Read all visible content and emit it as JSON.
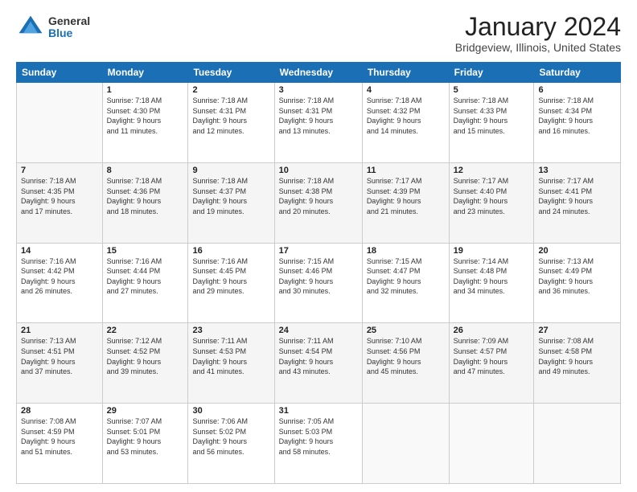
{
  "logo": {
    "general": "General",
    "blue": "Blue"
  },
  "title": "January 2024",
  "subtitle": "Bridgeview, Illinois, United States",
  "days_of_week": [
    "Sunday",
    "Monday",
    "Tuesday",
    "Wednesday",
    "Thursday",
    "Friday",
    "Saturday"
  ],
  "weeks": [
    [
      {
        "day": "",
        "info": ""
      },
      {
        "day": "1",
        "info": "Sunrise: 7:18 AM\nSunset: 4:30 PM\nDaylight: 9 hours\nand 11 minutes."
      },
      {
        "day": "2",
        "info": "Sunrise: 7:18 AM\nSunset: 4:31 PM\nDaylight: 9 hours\nand 12 minutes."
      },
      {
        "day": "3",
        "info": "Sunrise: 7:18 AM\nSunset: 4:31 PM\nDaylight: 9 hours\nand 13 minutes."
      },
      {
        "day": "4",
        "info": "Sunrise: 7:18 AM\nSunset: 4:32 PM\nDaylight: 9 hours\nand 14 minutes."
      },
      {
        "day": "5",
        "info": "Sunrise: 7:18 AM\nSunset: 4:33 PM\nDaylight: 9 hours\nand 15 minutes."
      },
      {
        "day": "6",
        "info": "Sunrise: 7:18 AM\nSunset: 4:34 PM\nDaylight: 9 hours\nand 16 minutes."
      }
    ],
    [
      {
        "day": "7",
        "info": "Sunrise: 7:18 AM\nSunset: 4:35 PM\nDaylight: 9 hours\nand 17 minutes."
      },
      {
        "day": "8",
        "info": "Sunrise: 7:18 AM\nSunset: 4:36 PM\nDaylight: 9 hours\nand 18 minutes."
      },
      {
        "day": "9",
        "info": "Sunrise: 7:18 AM\nSunset: 4:37 PM\nDaylight: 9 hours\nand 19 minutes."
      },
      {
        "day": "10",
        "info": "Sunrise: 7:18 AM\nSunset: 4:38 PM\nDaylight: 9 hours\nand 20 minutes."
      },
      {
        "day": "11",
        "info": "Sunrise: 7:17 AM\nSunset: 4:39 PM\nDaylight: 9 hours\nand 21 minutes."
      },
      {
        "day": "12",
        "info": "Sunrise: 7:17 AM\nSunset: 4:40 PM\nDaylight: 9 hours\nand 23 minutes."
      },
      {
        "day": "13",
        "info": "Sunrise: 7:17 AM\nSunset: 4:41 PM\nDaylight: 9 hours\nand 24 minutes."
      }
    ],
    [
      {
        "day": "14",
        "info": "Sunrise: 7:16 AM\nSunset: 4:42 PM\nDaylight: 9 hours\nand 26 minutes."
      },
      {
        "day": "15",
        "info": "Sunrise: 7:16 AM\nSunset: 4:44 PM\nDaylight: 9 hours\nand 27 minutes."
      },
      {
        "day": "16",
        "info": "Sunrise: 7:16 AM\nSunset: 4:45 PM\nDaylight: 9 hours\nand 29 minutes."
      },
      {
        "day": "17",
        "info": "Sunrise: 7:15 AM\nSunset: 4:46 PM\nDaylight: 9 hours\nand 30 minutes."
      },
      {
        "day": "18",
        "info": "Sunrise: 7:15 AM\nSunset: 4:47 PM\nDaylight: 9 hours\nand 32 minutes."
      },
      {
        "day": "19",
        "info": "Sunrise: 7:14 AM\nSunset: 4:48 PM\nDaylight: 9 hours\nand 34 minutes."
      },
      {
        "day": "20",
        "info": "Sunrise: 7:13 AM\nSunset: 4:49 PM\nDaylight: 9 hours\nand 36 minutes."
      }
    ],
    [
      {
        "day": "21",
        "info": "Sunrise: 7:13 AM\nSunset: 4:51 PM\nDaylight: 9 hours\nand 37 minutes."
      },
      {
        "day": "22",
        "info": "Sunrise: 7:12 AM\nSunset: 4:52 PM\nDaylight: 9 hours\nand 39 minutes."
      },
      {
        "day": "23",
        "info": "Sunrise: 7:11 AM\nSunset: 4:53 PM\nDaylight: 9 hours\nand 41 minutes."
      },
      {
        "day": "24",
        "info": "Sunrise: 7:11 AM\nSunset: 4:54 PM\nDaylight: 9 hours\nand 43 minutes."
      },
      {
        "day": "25",
        "info": "Sunrise: 7:10 AM\nSunset: 4:56 PM\nDaylight: 9 hours\nand 45 minutes."
      },
      {
        "day": "26",
        "info": "Sunrise: 7:09 AM\nSunset: 4:57 PM\nDaylight: 9 hours\nand 47 minutes."
      },
      {
        "day": "27",
        "info": "Sunrise: 7:08 AM\nSunset: 4:58 PM\nDaylight: 9 hours\nand 49 minutes."
      }
    ],
    [
      {
        "day": "28",
        "info": "Sunrise: 7:08 AM\nSunset: 4:59 PM\nDaylight: 9 hours\nand 51 minutes."
      },
      {
        "day": "29",
        "info": "Sunrise: 7:07 AM\nSunset: 5:01 PM\nDaylight: 9 hours\nand 53 minutes."
      },
      {
        "day": "30",
        "info": "Sunrise: 7:06 AM\nSunset: 5:02 PM\nDaylight: 9 hours\nand 56 minutes."
      },
      {
        "day": "31",
        "info": "Sunrise: 7:05 AM\nSunset: 5:03 PM\nDaylight: 9 hours\nand 58 minutes."
      },
      {
        "day": "",
        "info": ""
      },
      {
        "day": "",
        "info": ""
      },
      {
        "day": "",
        "info": ""
      }
    ]
  ]
}
